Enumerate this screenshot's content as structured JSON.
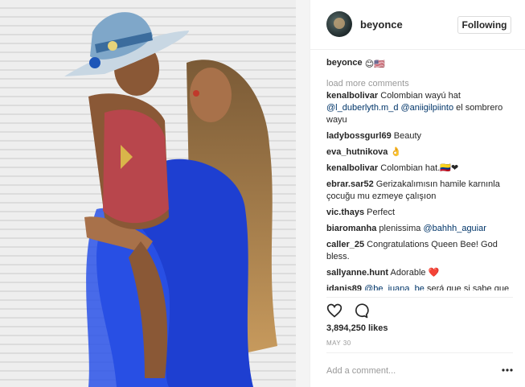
{
  "post": {
    "username": "beyonce",
    "follow_label": "Following",
    "caption_user": "beyonce",
    "caption_emoji": "😊🇺🇸",
    "load_more": "load more comments",
    "comments": [
      {
        "user": "kenalbolivar",
        "text": "Colombian wayú hat",
        "line2_m1": "@l_duberlyth.m_d",
        "line2_m2": "@aniigilpiinto",
        "line2_text": "el sombrero wayu"
      },
      {
        "user": "ladybossgurl69",
        "text": "Beauty"
      },
      {
        "user": "eva_hutnikova",
        "text": "👌"
      },
      {
        "user": "kenalbolivar",
        "text": "Colombian hat.🇨🇴❤"
      },
      {
        "user": "ebrar.sar52",
        "text": "Gerizakalımısın hamile karnınla çocuğu mu ezmeye çalışıon"
      },
      {
        "user": "vic.thays",
        "text": "Perfect"
      },
      {
        "user": "biaromanha",
        "text": "plenissima",
        "mention": "@bahhh_aguiar"
      },
      {
        "user": "caller_25",
        "text": "Congratulations Queen Bee! God bless."
      },
      {
        "user": "sallyanne.hunt",
        "text": "Adorable ❤️"
      },
      {
        "user": "idanis89",
        "mention": "@be_juana_be",
        "text": "será que si sabe que es wayuu"
      }
    ],
    "likes": "3,894,250 likes",
    "date": "MAY 30",
    "add_comment_placeholder": "Add a comment...",
    "icons": [
      "heart-icon",
      "comment-icon",
      "more-options-icon"
    ],
    "colors": {
      "text": "#262626",
      "muted": "#999999",
      "mention": "#003569",
      "border": "#efefef"
    }
  }
}
